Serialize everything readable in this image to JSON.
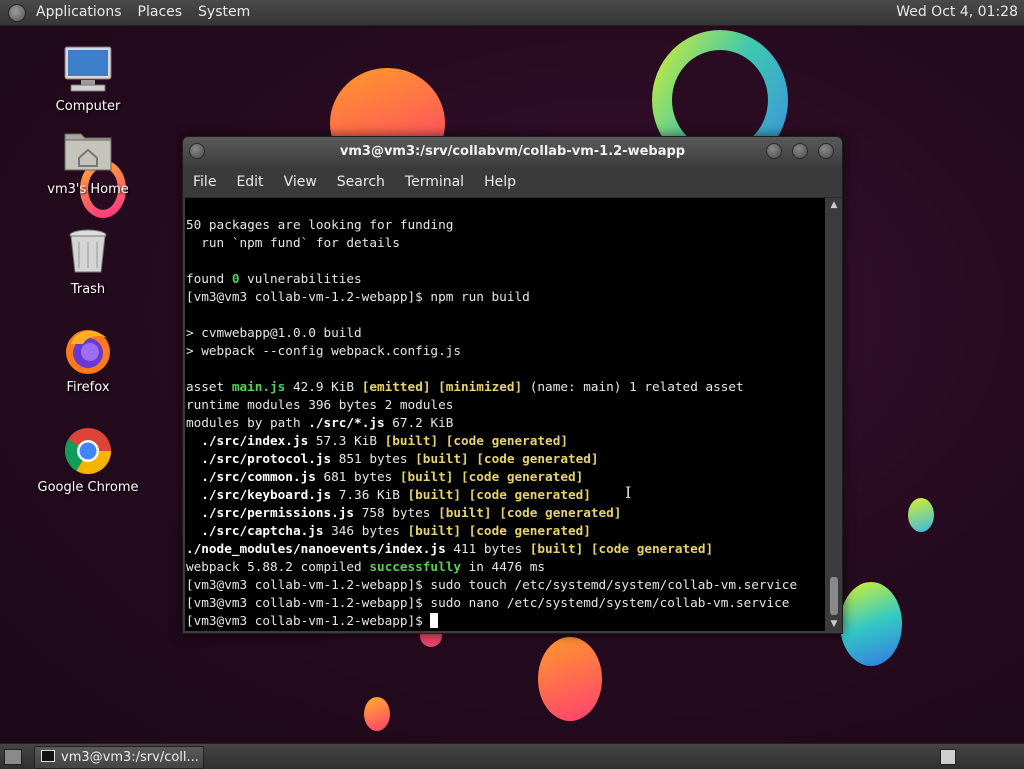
{
  "top_panel": {
    "menus": [
      "Applications",
      "Places",
      "System"
    ],
    "clock": "Wed Oct  4, 01:28"
  },
  "desktop_icons": [
    {
      "label": "Computer",
      "icon": "computer-icon"
    },
    {
      "label": "vm3's Home",
      "icon": "home-folder-icon"
    },
    {
      "label": "Trash",
      "icon": "trash-icon"
    },
    {
      "label": "Firefox",
      "icon": "firefox-icon"
    },
    {
      "label": "Google Chrome",
      "icon": "chrome-icon"
    }
  ],
  "window": {
    "title": "vm3@vm3:/srv/collabvm/collab-vm-1.2-webapp",
    "menus": [
      "File",
      "Edit",
      "View",
      "Search",
      "Terminal",
      "Help"
    ]
  },
  "terminal_lines": [
    "50 packages are looking for funding",
    "  run `npm fund` for details",
    "",
    "found 0 vulnerabilities",
    "[vm3@vm3 collab-vm-1.2-webapp]$ npm run build",
    "",
    "> cvmwebapp@1.0.0 build",
    "> webpack --config webpack.config.js",
    "",
    "asset main.js 42.9 KiB [emitted] [minimized] (name: main) 1 related asset",
    "runtime modules 396 bytes 2 modules",
    "modules by path ./src/*.js 67.2 KiB",
    "  ./src/index.js 57.3 KiB [built] [code generated]",
    "  ./src/protocol.js 851 bytes [built] [code generated]",
    "  ./src/common.js 681 bytes [built] [code generated]",
    "  ./src/keyboard.js 7.36 KiB [built] [code generated]",
    "  ./src/permissions.js 758 bytes [built] [code generated]",
    "  ./src/captcha.js 346 bytes [built] [code generated]",
    "./node_modules/nanoevents/index.js 411 bytes [built] [code generated]",
    "webpack 5.88.2 compiled successfully in 4476 ms",
    "[vm3@vm3 collab-vm-1.2-webapp]$ sudo touch /etc/systemd/system/collab-vm.service",
    "[vm3@vm3 collab-vm-1.2-webapp]$ sudo nano /etc/systemd/system/collab-vm.service",
    "[vm3@vm3 collab-vm-1.2-webapp]$ "
  ],
  "taskbar": {
    "task_label": "vm3@vm3:/srv/coll..."
  },
  "colors": {
    "success_green": "#55d055",
    "status_yellow": "#e6d36b",
    "terminal_bg": "#000000"
  }
}
